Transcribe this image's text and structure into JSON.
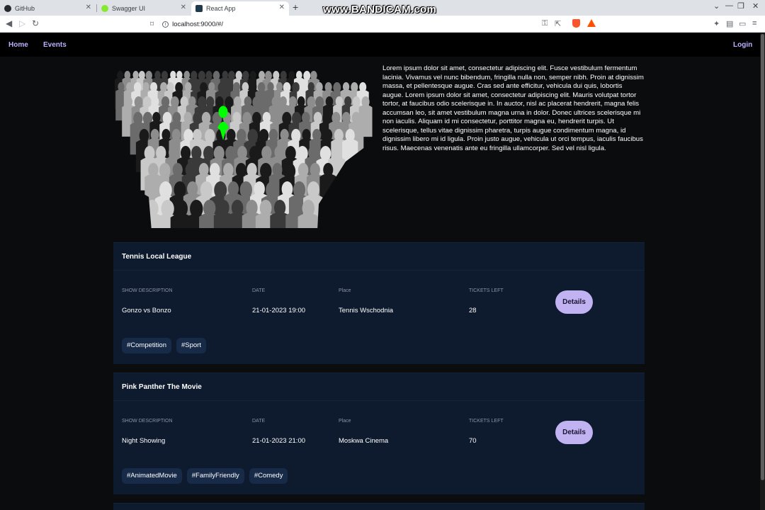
{
  "browser": {
    "tabs": [
      {
        "title": "GitHub",
        "icon": "github-icon"
      },
      {
        "title": "Swagger UI",
        "icon": "swagger-icon"
      },
      {
        "title": "React App",
        "icon": "react-icon"
      }
    ],
    "url": "localhost:9000/#/",
    "watermark": "www.BANDICAM.com"
  },
  "nav": {
    "home": "Home",
    "events": "Events",
    "login": "Login"
  },
  "hero": {
    "image_icon": "crowd-illustration",
    "highlight_color": "#00ff00",
    "text": "Lorem ipsum dolor sit amet, consectetur adipiscing elit. Fusce vestibulum fermentum lacinia. Vivamus vel nunc bibendum, fringilla nulla non, semper nibh. Proin at dignissim massa, et pellentesque augue. Cras sed ante efficitur, vehicula dui quis, lobortis augue. Lorem ipsum dolor sit amet, consectetur adipiscing elit. Mauris volutpat tortor tortor, at faucibus odio scelerisque in. In auctor, nisl ac placerat hendrerit, magna felis accumsan leo, sit amet vestibulum magna urna in dolor. Donec ultrices scelerisque mi non iaculis. Aliquam id mi consectetur, porttitor magna eu, hendrerit turpis. Ut scelerisque, tellus vitae dignissim pharetra, turpis augue condimentum magna, id dignissim libero mi id ligula. Proin justo augue, vehicula ut orci tempus, iaculis faucibus risus. Maecenas venenatis ante eu fringilla ullamcorper. Sed vel nisl ligula."
  },
  "labels": {
    "show_description": "SHOW DESCRIPTION",
    "date": "DATE",
    "place": "Place",
    "tickets_left": "TICKETS LEFT",
    "details": "Details"
  },
  "events": [
    {
      "title": "Tennis Local League",
      "description": "Gonzo vs Bonzo",
      "date": "21-01-2023 19:00",
      "place": "Tennis Wschodnia",
      "tickets_left": "28",
      "tags": [
        "#Competition",
        "#Sport"
      ]
    },
    {
      "title": "Pink Panther The Movie",
      "description": "Night Showing",
      "date": "21-01-2023 21:00",
      "place": "Moskwa Cinema",
      "tickets_left": "70",
      "tags": [
        "#AnimatedMovie",
        "#FamilyFriendly",
        "#Comedy"
      ]
    }
  ],
  "colors": {
    "accent": "#c1b3f2",
    "nav_link": "#b9b2ff",
    "card_bg": "#0e1a2d",
    "tag_bg": "#172a47"
  }
}
